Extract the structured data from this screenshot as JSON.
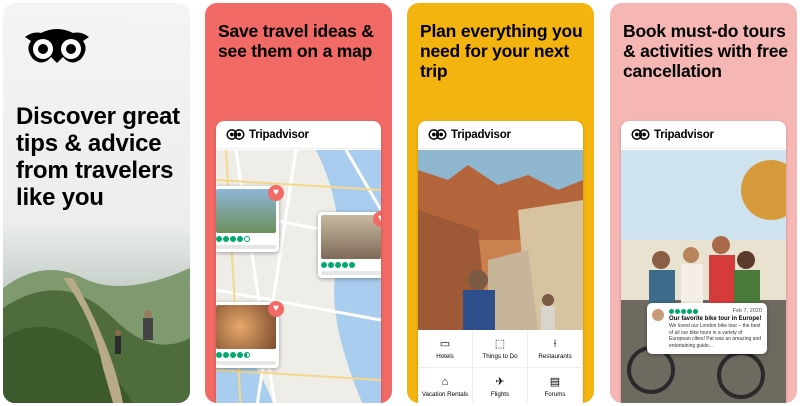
{
  "panels": [
    {
      "headline": "Discover great tips & advice from travelers like you"
    },
    {
      "headline": "Save travel ideas & see them on a map"
    },
    {
      "headline": "Plan everything you need for your next trip"
    },
    {
      "headline": "Book must-do tours & activities with free cancellation"
    }
  ],
  "brand": {
    "name": "Tripadvisor"
  },
  "nav": [
    {
      "icon": "hotel-icon",
      "glyph": "▭",
      "label": "Hotels"
    },
    {
      "icon": "things-to-do-icon",
      "glyph": "⬚",
      "label": "Things to Do"
    },
    {
      "icon": "restaurant-icon",
      "glyph": "⟊",
      "label": "Restaurants"
    },
    {
      "icon": "home-icon",
      "glyph": "⌂",
      "label": "Vacation Rentals"
    },
    {
      "icon": "plane-icon",
      "glyph": "✈",
      "label": "Flights"
    },
    {
      "icon": "forums-icon",
      "glyph": "▤",
      "label": "Forums"
    }
  ],
  "review": {
    "date": "Feb 7, 2020",
    "title": "Our favorite bike tour in Europe!",
    "body": "We loved our London bike tour – the best of all our bike tours in a variety of European cities! Pat was an amazing and entertaining guide...",
    "rating": 5
  },
  "map_cards": [
    {
      "rating": 4
    },
    {
      "rating": 5
    },
    {
      "rating": 4.5
    }
  ],
  "colors": {
    "panel2": "#f26a65",
    "panel3": "#f3b40f",
    "panel4": "#f6b6b4",
    "rating_green": "#00aa6c"
  }
}
